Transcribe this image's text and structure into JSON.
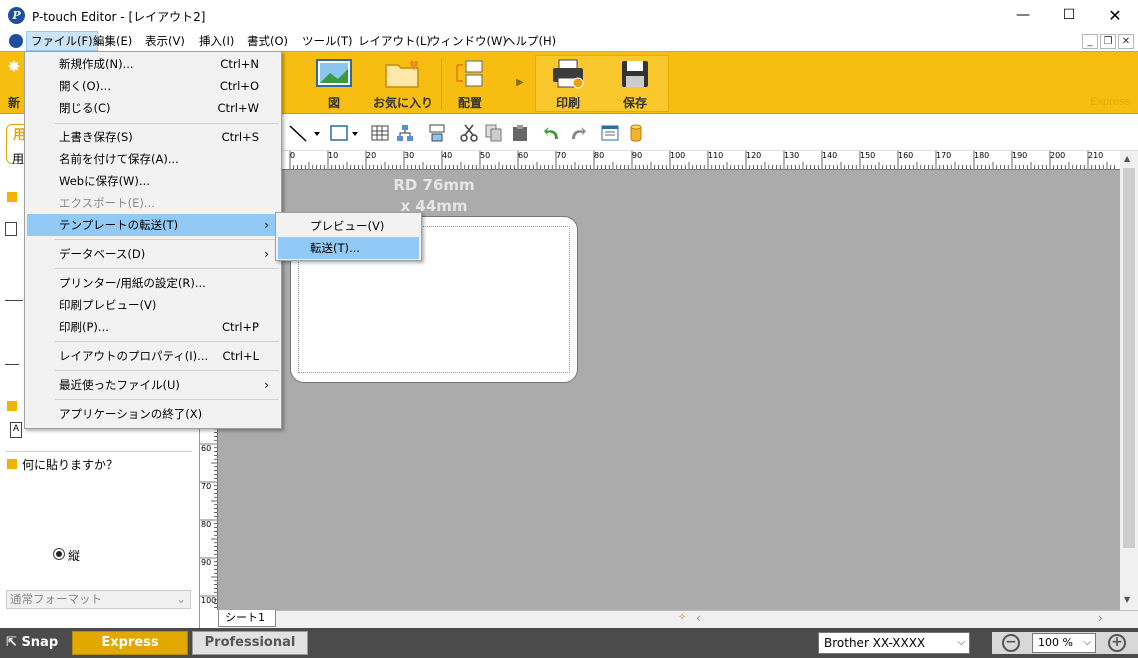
{
  "window": {
    "title": "P-touch Editor - [レイアウト2]",
    "controls": {
      "minimize": "—",
      "maximize": "☐",
      "close": "✕"
    }
  },
  "menubar": {
    "items": [
      {
        "label": "ファイル(F)"
      },
      {
        "label": "編集(E)"
      },
      {
        "label": "表示(V)"
      },
      {
        "label": "挿入(I)"
      },
      {
        "label": "書式(O)"
      },
      {
        "label": "ツール(T)"
      },
      {
        "label": "レイアウト(L)"
      },
      {
        "label": "ウィンドウ(W)"
      },
      {
        "label": "ヘルプ(H)"
      }
    ],
    "mdi": {
      "minimize": "_",
      "restore": "❐",
      "close": "✕"
    }
  },
  "ribbon": {
    "new_partial": "新",
    "buttons": [
      {
        "label": "図",
        "icon": "picture-icon"
      },
      {
        "label": "お気に入り",
        "icon": "favorites-folder-icon"
      },
      {
        "label": "配置",
        "icon": "arrange-icon"
      },
      {
        "label": "印刷",
        "icon": "printer-icon"
      },
      {
        "label": "保存",
        "icon": "floppy-save-icon"
      }
    ],
    "mode_label": "Express",
    "colors": {
      "ribbon": "#f7be11",
      "express_accent": "#e1a800",
      "highlight": "#91c9f7"
    }
  },
  "left_panel": {
    "paper_partial_a": "用",
    "paper_partial_b": "用",
    "orientation_label": "縦",
    "purpose_heading": "何に貼りますか？",
    "format_select": "通常フォーマット"
  },
  "canvas": {
    "label_caption_line1": "RD 76mm",
    "label_caption_line2": "x 44mm",
    "sheet_tab": "シート1"
  },
  "ruler": {
    "h_numbers": [
      "0",
      "10",
      "20",
      "30",
      "40",
      "50",
      "60",
      "70",
      "80",
      "90",
      "100",
      "110",
      "120",
      "130",
      "140",
      "150",
      "160",
      "170",
      "180",
      "190",
      "200",
      "210"
    ],
    "v_numbers": [
      "60",
      "70",
      "80",
      "90",
      "100"
    ]
  },
  "file_menu": {
    "items": [
      {
        "label": "新規作成(N)...",
        "shortcut": "Ctrl+N"
      },
      {
        "label": "開く(O)...",
        "shortcut": "Ctrl+O"
      },
      {
        "label": "閉じる(C)",
        "shortcut": "Ctrl+W"
      },
      {
        "label": "上書き保存(S)",
        "shortcut": "Ctrl+S"
      },
      {
        "label": "名前を付けて保存(A)...",
        "shortcut": ""
      },
      {
        "label": "Webに保存(W)...",
        "shortcut": ""
      },
      {
        "label": "エクスポート(E)...",
        "shortcut": ""
      },
      {
        "label": "テンプレートの転送(T)",
        "shortcut": ""
      },
      {
        "label": "データベース(D)",
        "shortcut": ""
      },
      {
        "label": "プリンター/用紙の設定(R)...",
        "shortcut": ""
      },
      {
        "label": "印刷プレビュー(V)",
        "shortcut": ""
      },
      {
        "label": "印刷(P)...",
        "shortcut": "Ctrl+P"
      },
      {
        "label": "レイアウトのプロパティ(I)...",
        "shortcut": "Ctrl+L"
      },
      {
        "label": "最近使ったファイル(U)",
        "shortcut": ""
      },
      {
        "label": "アプリケーションの終了(X)",
        "shortcut": ""
      }
    ],
    "submenu_arrow": "›"
  },
  "submenu": {
    "items": [
      {
        "label": "プレビュー(V)"
      },
      {
        "label": "転送(T)..."
      }
    ]
  },
  "statusbar": {
    "snap": "Snap",
    "express": "Express",
    "professional": "Professional",
    "printer": "Brother XX-XXXX",
    "zoom": "100 %"
  }
}
